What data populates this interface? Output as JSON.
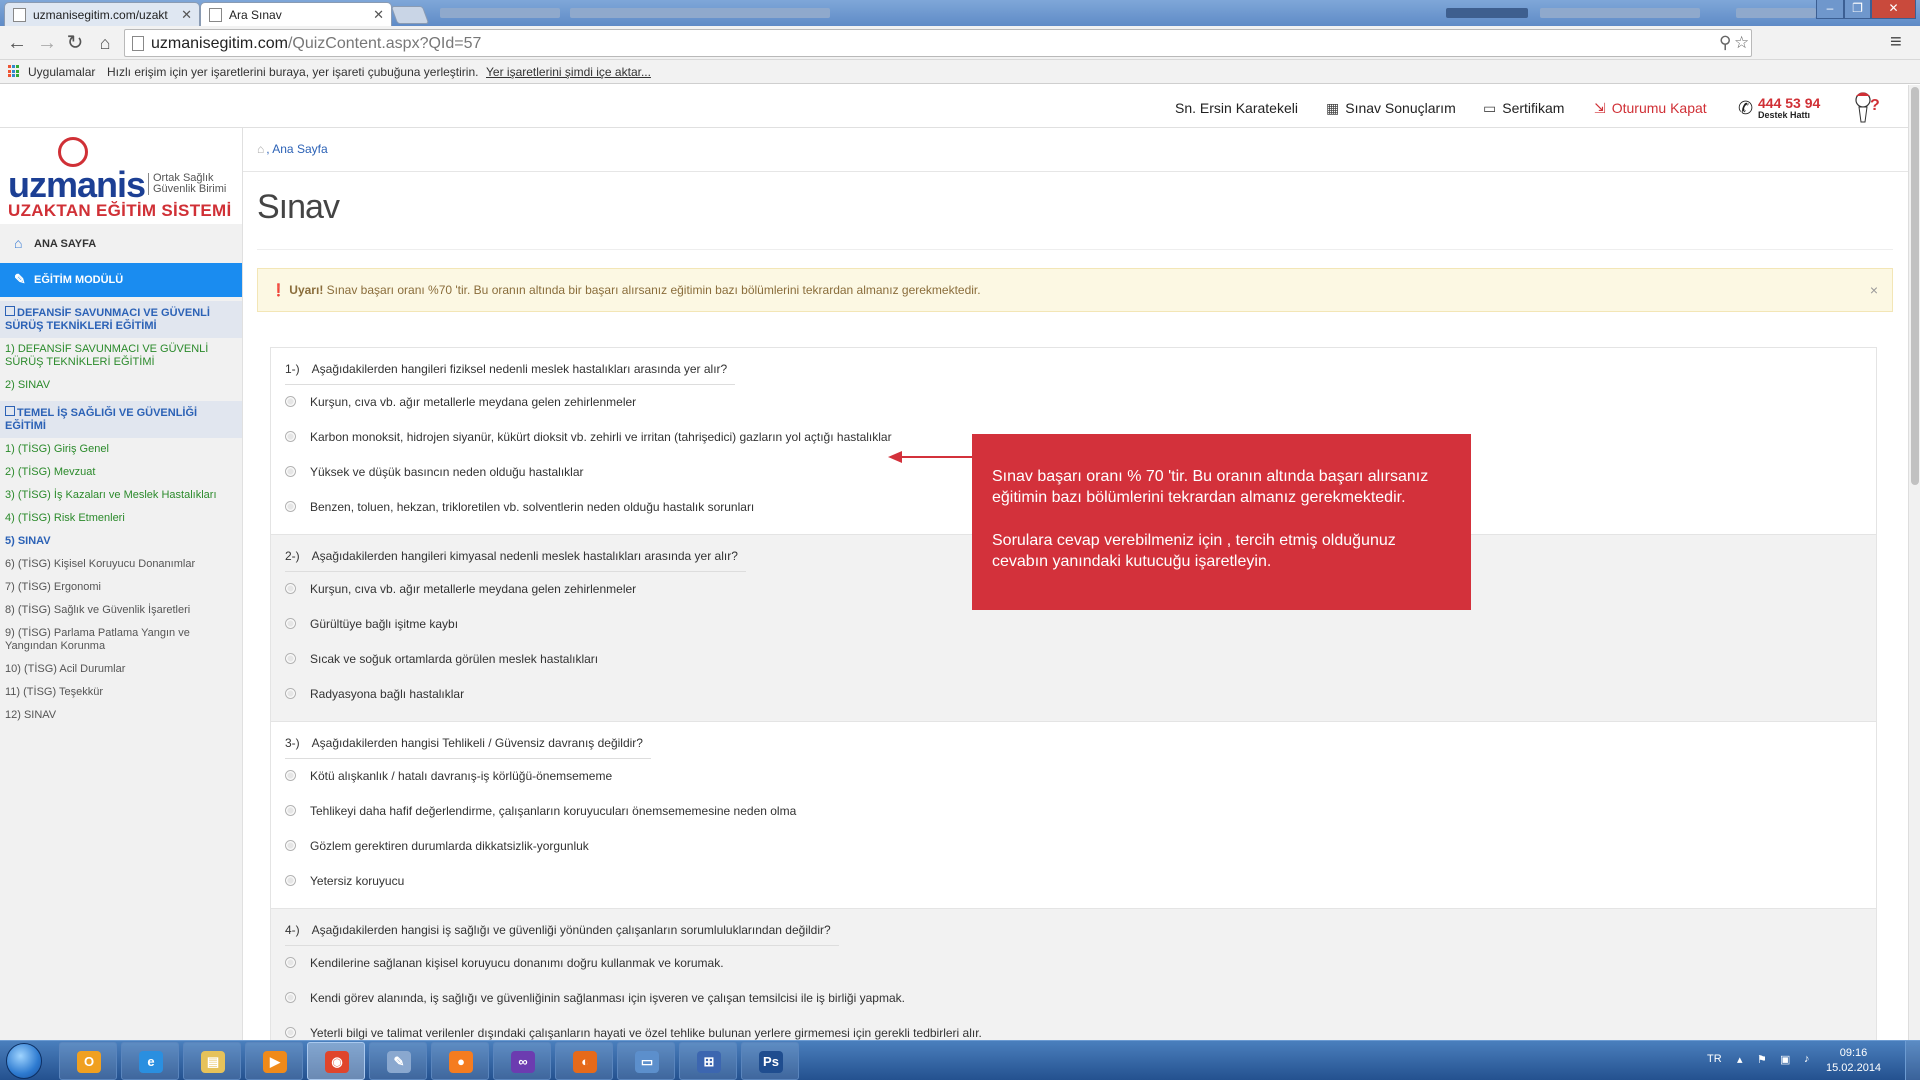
{
  "browser": {
    "tabs": [
      {
        "label": "uzmanisegitim.com/uzakt"
      },
      {
        "label": "Ara Sınav"
      }
    ],
    "url_host": "uzmanisegitim.com",
    "url_path": "/QuizContent.aspx?QId=57",
    "bookmarks": {
      "apps_label": "Uygulamalar",
      "hint": "Hızlı erişim için yer işaretlerini buraya, yer işareti çubuğuna yerleştirin.",
      "import_link": "Yer işaretlerini şimdi içe aktar..."
    }
  },
  "topnav": {
    "user": "Sn. Ersin Karatekeli",
    "results": "Sınav Sonuçlarım",
    "certificate": "Sertifikam",
    "logout": "Oturumu Kapat",
    "support_number": "444 53 94",
    "support_label": "Destek Hattı"
  },
  "logo": {
    "brand": "uzmanis",
    "sub_line1": "Ortak Sağlık",
    "sub_line2": "Güvenlik Birimi",
    "system": "UZAKTAN EĞİTİM SİSTEMİ"
  },
  "sidebar": {
    "home": "ANA SAYFA",
    "module": "EĞİTİM MODÜLÜ",
    "items": [
      {
        "label": "DEFANSİF SAVUNMACI VE GÜVENLİ SÜRÜŞ TEKNİKLERİ EĞİTİMİ",
        "style": "head"
      },
      {
        "label": "1) DEFANSİF SAVUNMACI VE GÜVENLİ SÜRÜŞ TEKNİKLERİ EĞİTİMİ",
        "style": "green"
      },
      {
        "label": "2) SINAV",
        "style": "green"
      },
      {
        "label": "TEMEL İŞ SAĞLIĞI VE GÜVENLİĞİ EĞİTİMİ",
        "style": "head"
      },
      {
        "label": "1) (TİSG) Giriş Genel",
        "style": "green"
      },
      {
        "label": "2) (TİSG) Mevzuat",
        "style": "green"
      },
      {
        "label": "3) (TİSG) İş Kazaları ve Meslek Hastalıkları",
        "style": "green"
      },
      {
        "label": "4) (TİSG) Risk Etmenleri",
        "style": "green"
      },
      {
        "label": "5) SINAV",
        "style": "blue"
      },
      {
        "label": "6) (TİSG) Kişisel Koruyucu Donanımlar",
        "style": "gray"
      },
      {
        "label": "7) (TİSG) Ergonomi",
        "style": "gray"
      },
      {
        "label": "8) (TİSG) Sağlık ve Güvenlik İşaretleri",
        "style": "gray"
      },
      {
        "label": "9) (TİSG) Parlama Patlama Yangın ve Yangından Korunma",
        "style": "gray"
      },
      {
        "label": "10) (TİSG) Acil Durumlar",
        "style": "gray"
      },
      {
        "label": "11) (TİSG) Teşekkür",
        "style": "gray"
      },
      {
        "label": "12) SINAV",
        "style": "gray"
      }
    ]
  },
  "content": {
    "breadcrumb": ", Ana Sayfa",
    "title": "Sınav",
    "alert_label": "Uyarı!",
    "alert_text": " Sınav başarı oranı %70 'tir. Bu oranın altında bir başarı alırsanız eğitimin bazı bölümlerini tekrardan almanız gerekmektedir.",
    "alert_close": "×"
  },
  "questions": [
    {
      "no": "1-)",
      "text": "Aşağıdakilerden hangileri fiziksel nedenli meslek hastalıkları arasında yer alır?",
      "options": [
        "Kurşun, cıva vb. ağır metallerle meydana gelen zehirlenmeler",
        "Karbon monoksit, hidrojen siyanür, kükürt dioksit vb. zehirli ve irritan (tahrişedici) gazların yol açtığı hastalıklar",
        "Yüksek ve düşük basıncın neden olduğu hastalıklar",
        "Benzen, toluen, hekzan, trikloretilen vb. solventlerin neden olduğu hastalık sorunları"
      ]
    },
    {
      "no": "2-)",
      "text": "Aşağıdakilerden hangileri kimyasal nedenli meslek hastalıkları arasında yer alır?",
      "options": [
        "Kurşun, cıva vb. ağır metallerle meydana gelen zehirlenmeler",
        "Gürültüye bağlı işitme kaybı",
        "Sıcak ve soğuk ortamlarda görülen meslek hastalıkları",
        "Radyasyona bağlı hastalıklar"
      ]
    },
    {
      "no": "3-)",
      "text": "Aşağıdakilerden hangisi Tehlikeli / Güvensiz davranış değildir?",
      "options": [
        "Kötü alışkanlık / hatalı davranış-iş körlüğü-önemsememe",
        "Tehlikeyi daha hafif değerlendirme, çalışanların koruyucuları önemsememesine neden olma",
        "Gözlem gerektiren durumlarda dikkatsizlik-yorgunluk",
        "Yetersiz koruyucu"
      ]
    },
    {
      "no": "4-)",
      "text": "Aşağıdakilerden hangisi iş sağlığı ve güvenliği yönünden çalışanların sorumluluklarından değildir?",
      "options": [
        "Kendilerine sağlanan kişisel koruyucu donanımı doğru kullanmak ve korumak.",
        "Kendi görev alanında, iş sağlığı ve güvenliğinin sağlanması için işveren ve çalışan temsilcisi ile iş birliği yapmak.",
        "Yeterli bilgi ve talimat verilenler dışındaki çalışanların hayati ve özel tehlike bulunan yerlere girmemesi için gerekli tedbirleri alır."
      ]
    }
  ],
  "callout": {
    "p1": "Sınav başarı oranı % 70 'tir. Bu oranın altında başarı alırsanız eğitimin bazı bölümlerini tekrardan almanız gerekmektedir.",
    "p2": "Sorulara cevap verebilmeniz için , tercih etmiş olduğunuz cevabın yanındaki kutucuğu işaretleyin."
  },
  "taskbar": {
    "lang": "TR",
    "time": "09:16",
    "date": "15.02.2014",
    "apps": [
      "outlook-icon",
      "ie-icon",
      "explorer-icon",
      "media-player-icon",
      "chrome-icon",
      "tool-icon",
      "app-icon",
      "visual-studio-icon",
      "firefox-icon",
      "remote-desktop-icon",
      "network-icon",
      "photoshop-icon"
    ]
  },
  "colors": {
    "accent_blue": "#1a8cf0",
    "brand_red": "#d3313b",
    "brand_navy": "#1c3f94"
  }
}
